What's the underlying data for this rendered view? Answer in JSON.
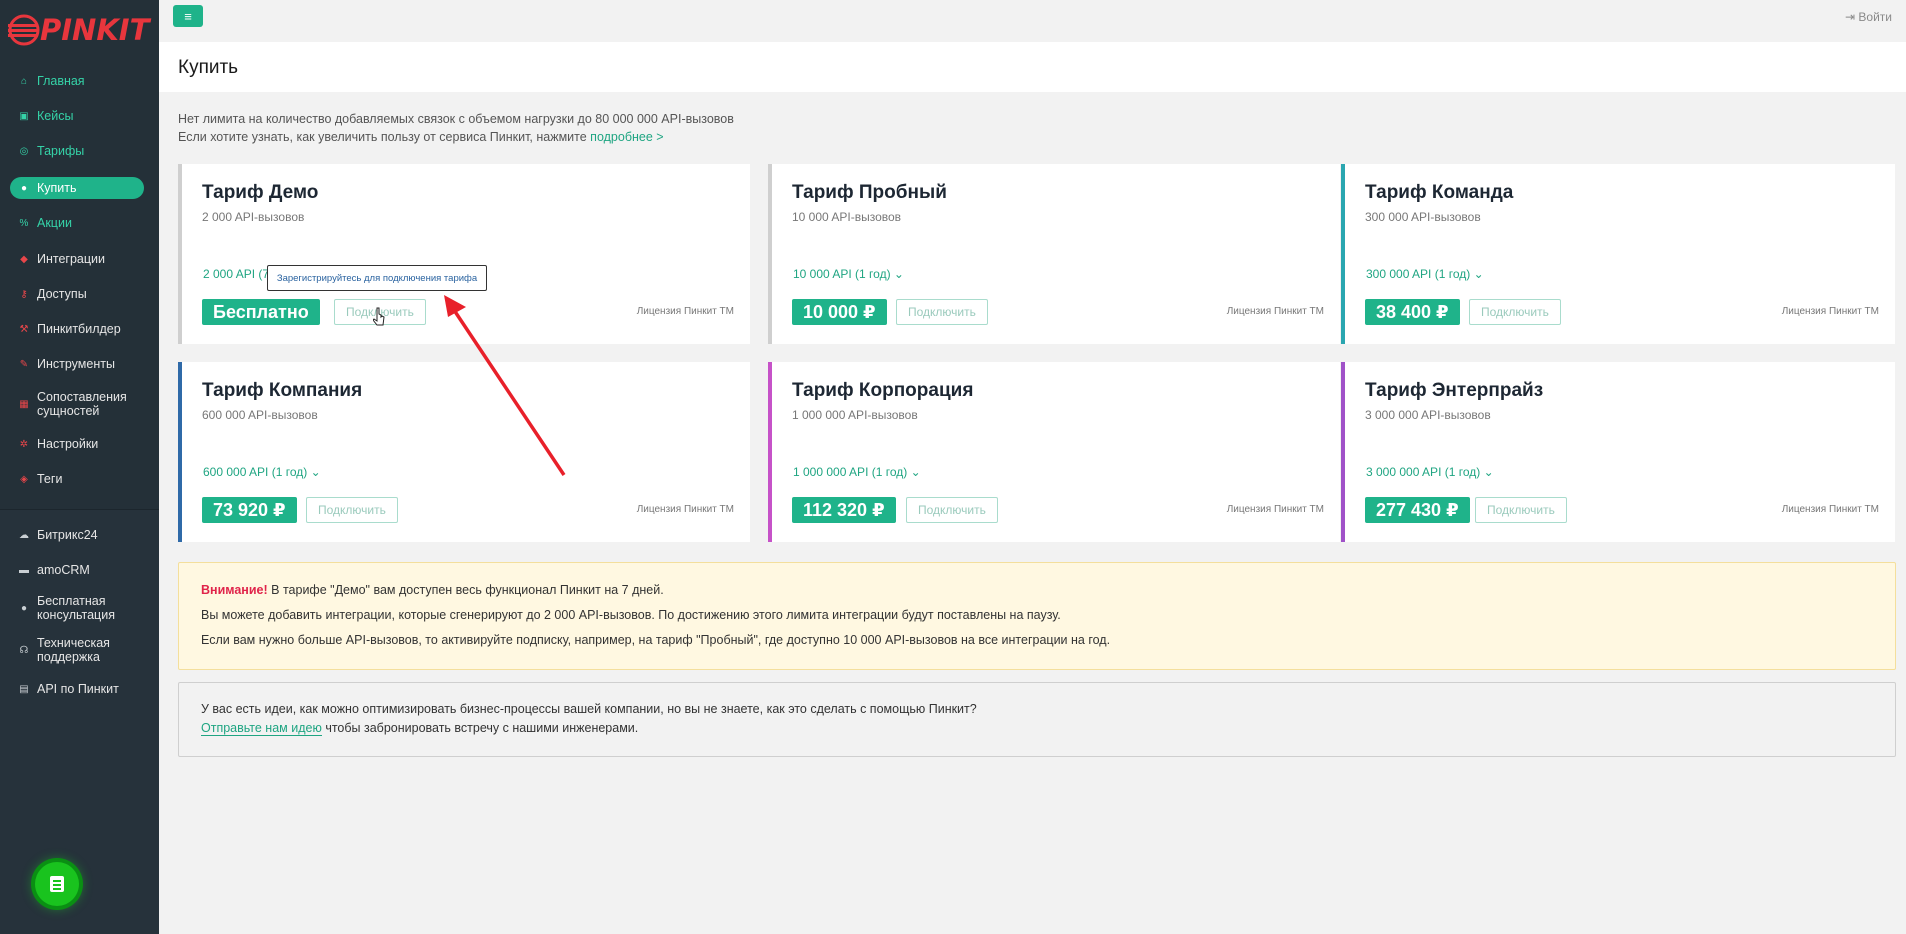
{
  "brand": {
    "logo_text": "PINKIT"
  },
  "sidebar": {
    "items": [
      {
        "label": "Главная",
        "icon": "home-icon"
      },
      {
        "label": "Кейсы",
        "icon": "briefcase-icon"
      },
      {
        "label": "Тарифы",
        "icon": "tariff-icon"
      },
      {
        "label": "Купить",
        "icon": "buy-icon"
      },
      {
        "label": "Акции",
        "icon": "percent-icon"
      },
      {
        "label": "Интеграции",
        "icon": "plug-icon"
      },
      {
        "label": "Доступы",
        "icon": "key-icon"
      },
      {
        "label": "Пинкитбилдер",
        "icon": "hammer-icon"
      },
      {
        "label": "Инструменты",
        "icon": "wrench-icon"
      },
      {
        "label": "Сопоставления сущностей",
        "icon": "table-icon"
      },
      {
        "label": "Настройки",
        "icon": "gear-icon"
      },
      {
        "label": "Теги",
        "icon": "tag-icon"
      }
    ],
    "bottom_items": [
      {
        "label": "Битрикс24",
        "icon": "cloud-icon"
      },
      {
        "label": "amoCRM",
        "icon": "crm-icon"
      },
      {
        "label": "Бесплатная консультация",
        "icon": "user-icon"
      },
      {
        "label": "Техническая поддержка",
        "icon": "headset-icon"
      },
      {
        "label": "API по Пинкит",
        "icon": "api-icon"
      }
    ]
  },
  "topbar": {
    "menu_icon": "≡",
    "login_label": "Войти"
  },
  "page": {
    "title": "Купить"
  },
  "intro": {
    "line1": "Нет лимита на количество добавляемых связок с объемом нагрузки до 80 000 000 API-вызовов",
    "line2": "Если хотите узнать, как увеличить пользу от сервиса Пинкит, нажмите",
    "link": "подробнее >"
  },
  "plans": [
    {
      "name": "Тариф Демо",
      "calls": "2 000 API-вызовов",
      "period": "2 000 API (7",
      "price": "Бесплатно",
      "button": "Подключить",
      "license": "Лицензия Пинкит ТМ",
      "accent": "#cfcfcf"
    },
    {
      "name": "Тариф Пробный",
      "calls": "10 000 API-вызовов",
      "period": "10 000 API (1 год)",
      "price": "10 000 ₽",
      "button": "Подключить",
      "license": "Лицензия Пинкит ТМ",
      "accent": "#cfcfcf"
    },
    {
      "name": "Тариф Команда",
      "calls": "300 000 API-вызовов",
      "period": "300 000 API (1 год)",
      "price": "38 400 ₽",
      "button": "Подключить",
      "license": "Лицензия Пинкит ТМ",
      "accent": "#2aa6b0"
    },
    {
      "name": "Тариф Компания",
      "calls": "600 000 API-вызовов",
      "period": "600 000 API (1 год)",
      "price": "73 920 ₽",
      "button": "Подключить",
      "license": "Лицензия Пинкит ТМ",
      "accent": "#2f6aa8"
    },
    {
      "name": "Тариф Корпорация",
      "calls": "1 000 000 API-вызовов",
      "period": "1 000 000 API (1 год)",
      "price": "112 320 ₽",
      "button": "Подключить",
      "license": "Лицензия Пинкит ТМ",
      "accent": "#c652c8"
    },
    {
      "name": "Тариф Энтерпрайз",
      "calls": "3 000 000 API-вызовов",
      "period": "3 000 000 API (1 год)",
      "price": "277 430 ₽",
      "button": "Подключить",
      "license": "Лицензия Пинкит ТМ",
      "accent": "#a052c8"
    }
  ],
  "tooltip": "Зарегистрируйтесь для подключения тарифа",
  "warning": {
    "title": "Внимание!",
    "line1": "В тарифе \"Демо\" вам доступен весь функционал Пинкит на 7 дней.",
    "line2": "Вы можете добавить интеграции, которые сгенерируют до 2 000 API-вызовов. По достижению этого лимита интеграции будут поставлены на паузу.",
    "line3": "Если вам нужно больше API-вызовов, то активируйте подписку, например, на тариф \"Пробный\", где доступно 10 000 API-вызовов на все интеграции на год."
  },
  "idea": {
    "line1": "У вас есть идеи, как можно оптимизировать бизнес-процессы вашей компании, но вы не знаете, как это сделать с помощью Пинкит?",
    "link": "Отправьте нам идею",
    "line2": " чтобы забронировать встречу с нашими инженерами."
  },
  "colors": {
    "accent": "#1fb38a",
    "sidebar": "#243038",
    "warning_bg": "#fff8e1",
    "arrow": "#e8202a"
  }
}
